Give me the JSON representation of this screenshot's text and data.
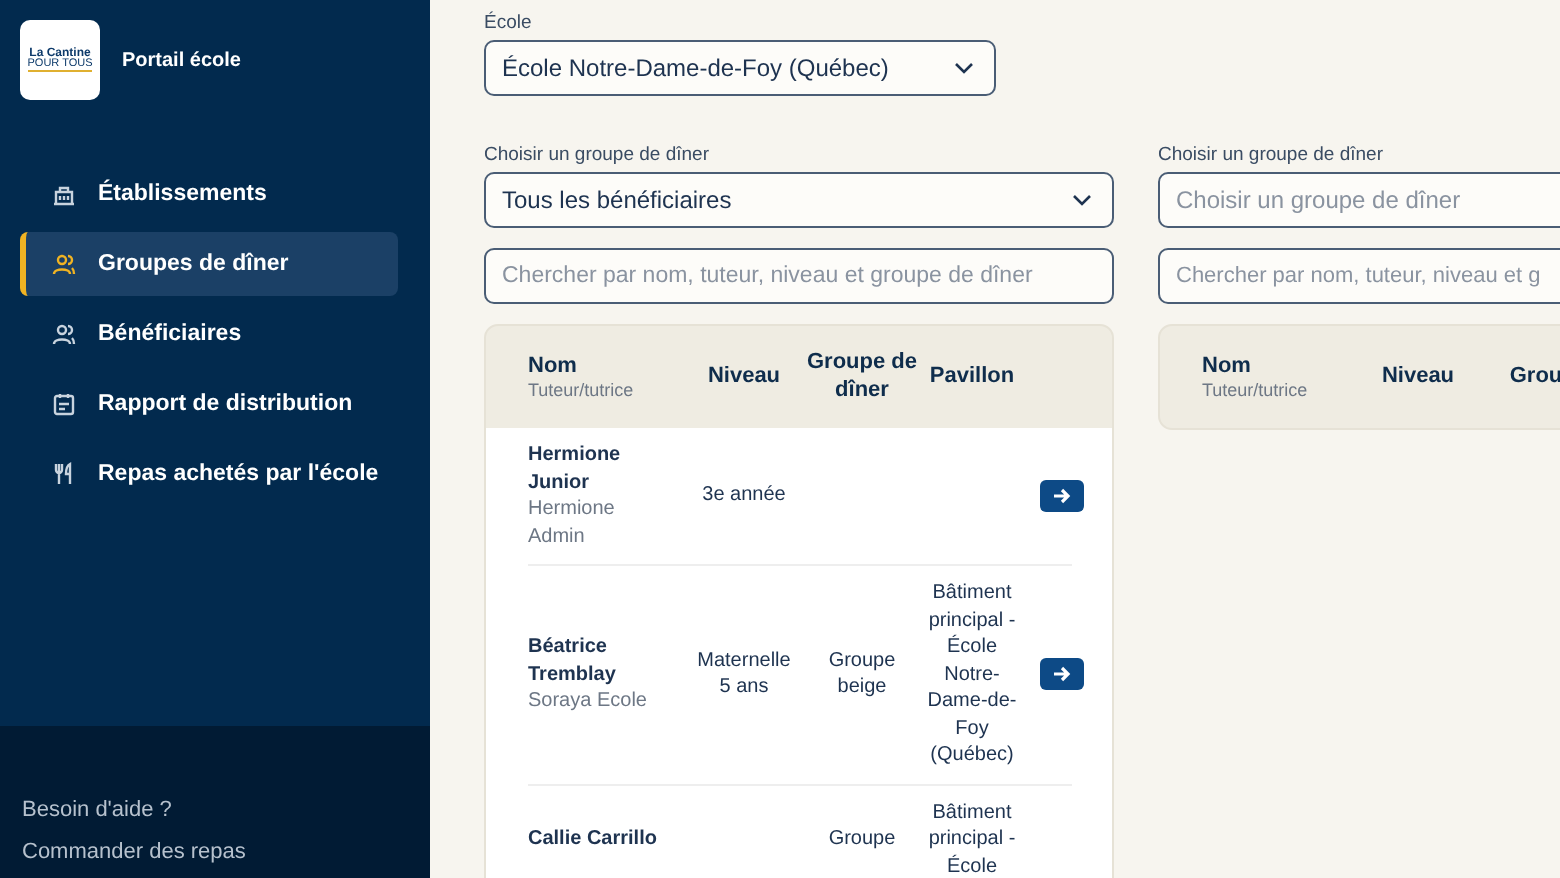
{
  "sidebar": {
    "logo": {
      "line_1": "La Cantine",
      "line_2": "POUR TOUS"
    },
    "portal_title": "Portail école",
    "nav_items": [
      {
        "label": "Établissements",
        "kind": "building",
        "selected": false
      },
      {
        "label": "Groupes de dîner",
        "kind": "group",
        "selected": true
      },
      {
        "label": "Bénéficiaires",
        "kind": "people",
        "selected": false
      },
      {
        "label": "Rapport de distribution",
        "kind": "calendar",
        "selected": false
      },
      {
        "label": "Repas achetés par l'école",
        "kind": "utensils",
        "selected": false
      }
    ],
    "footer_links": [
      "Besoin d'aide ?",
      "Commander des repas"
    ]
  },
  "school_field": {
    "label": "École",
    "value": "École Notre-Dame-de-Foy (Québec)"
  },
  "panels": [
    {
      "group_field": {
        "label": "Choisir un groupe de dîner",
        "value": "Tous les bénéficiaires"
      },
      "search": {
        "placeholder": "Chercher par nom, tuteur, niveau et groupe de dîner"
      },
      "table": {
        "columns": [
          {
            "label": "Nom",
            "sublabel": "Tuteur/tutrice"
          },
          {
            "label": "Niveau"
          },
          {
            "label": "Groupe de dîner"
          },
          {
            "label": "Pavillon"
          }
        ],
        "rows": [
          {
            "name": "Hermione Junior",
            "tutor": "Hermione Admin",
            "level": "3e année",
            "open": true
          },
          {
            "name": "Béatrice Tremblay",
            "tutor": "Soraya Ecole",
            "level": "Maternelle 5 ans",
            "group": "Groupe beige",
            "pavilion": "Bâtiment principal - École Notre-Dame-de-Foy (Québec)",
            "open": true
          },
          {
            "name": "Callie Carrillo",
            "group": "Groupe",
            "pavilion": "Bâtiment principal - École",
            "open": false
          }
        ]
      }
    },
    {
      "group_field": {
        "label": "Choisir un groupe de dîner",
        "placeholder": "Choisir un groupe de dîner"
      },
      "search": {
        "placeholder": "Chercher par nom, tuteur, niveau et g"
      },
      "table": {
        "columns": [
          {
            "label": "Nom",
            "sublabel": "Tuteur/tutrice"
          },
          {
            "label": "Niveau"
          },
          {
            "label": "Grou"
          }
        ]
      }
    }
  ]
}
